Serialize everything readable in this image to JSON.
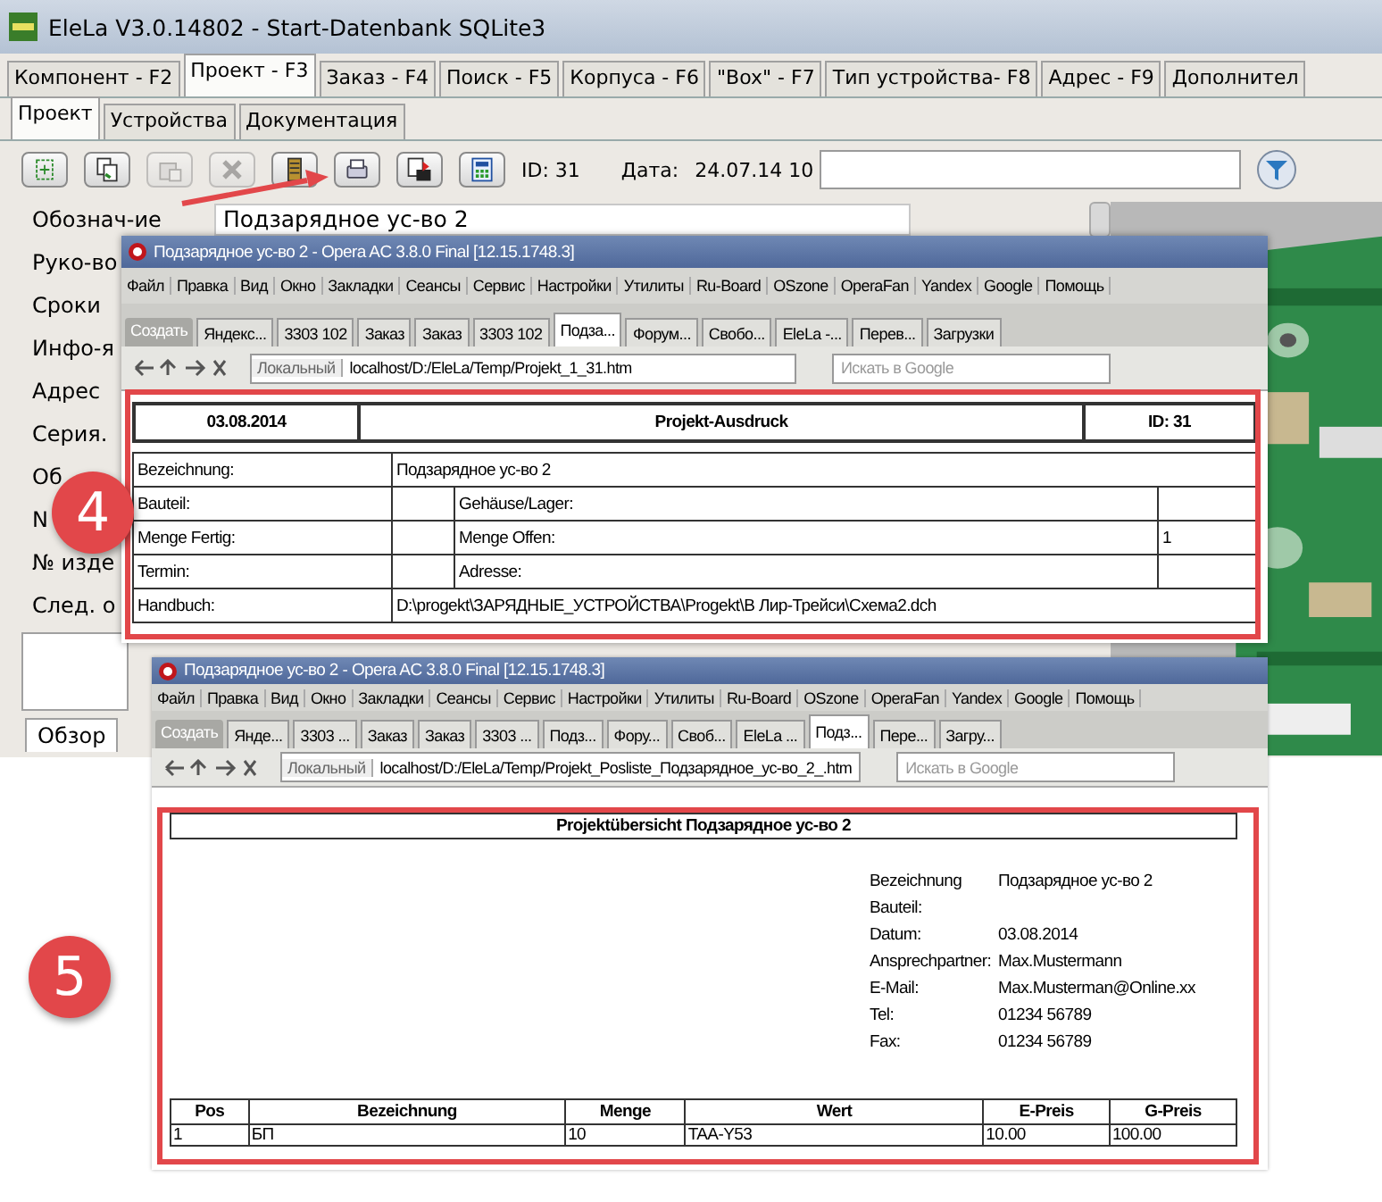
{
  "window": {
    "title": "EleLa V3.0.14802  - Start-Datenbank SQLite3"
  },
  "main_tabs": [
    {
      "label": "Компонент - F2",
      "selected": false
    },
    {
      "label": "Проект - F3",
      "selected": true
    },
    {
      "label": "Заказ - F4",
      "selected": false
    },
    {
      "label": "Поиск - F5",
      "selected": false
    },
    {
      "label": "Корпуса - F6",
      "selected": false
    },
    {
      "label": "\"Box\" - F7",
      "selected": false
    },
    {
      "label": "Тип устройства- F8",
      "selected": false
    },
    {
      "label": "Адрес - F9",
      "selected": false
    },
    {
      "label": "Дополнител",
      "selected": false
    }
  ],
  "sub_tabs": [
    {
      "label": "Проект",
      "selected": true
    },
    {
      "label": "Устройства",
      "selected": false
    },
    {
      "label": "Документация",
      "selected": false
    }
  ],
  "toolbar": {
    "buttons": [
      {
        "kind": "new",
        "disabled": false
      },
      {
        "kind": "copy",
        "disabled": false
      },
      {
        "kind": "paste",
        "disabled": true
      },
      {
        "kind": "delete",
        "disabled": true
      },
      {
        "kind": "book",
        "disabled": false
      },
      {
        "kind": "print",
        "disabled": false
      },
      {
        "kind": "export",
        "disabled": false
      },
      {
        "kind": "calc",
        "disabled": false
      }
    ],
    "id_text": "ID: 31",
    "date_label": "Дата:",
    "date_value": "24.07.14 10"
  },
  "form": {
    "fields": [
      {
        "label": "Обознач-ие",
        "value": "Подзарядное ус-во 2"
      },
      {
        "label": "Руко-во"
      },
      {
        "label": "Сроки"
      },
      {
        "label": "Инфо-я"
      },
      {
        "label": "Адрес"
      },
      {
        "label": "Серия."
      },
      {
        "label": "Об"
      },
      {
        "label": "N"
      },
      {
        "label": "№ изде"
      },
      {
        "label": "След. о"
      }
    ]
  },
  "bottom_tabs": [
    {
      "label": "Обзор",
      "selected": true
    }
  ],
  "browsers": [
    {
      "title": "Подзарядное ус-во 2 - Opera AC 3.8.0 Final [12.15.1748.3]",
      "menu": [
        "Файл",
        "Правка",
        "Вид",
        "Окно",
        "Закладки",
        "Сеансы",
        "Сервис",
        "Настройки",
        "Утилиты",
        "Ru-Board",
        "OSzone",
        "OperaFan",
        "Yandex",
        "Google",
        "Помощь"
      ],
      "new_tab": "Создать",
      "tabs": [
        {
          "label": "Яндекс...",
          "selected": false
        },
        {
          "label": "3303 102",
          "selected": false
        },
        {
          "label": "Заказ",
          "selected": false
        },
        {
          "label": "Заказ",
          "selected": false
        },
        {
          "label": "3303 102",
          "selected": false
        },
        {
          "label": "Подза...",
          "selected": true
        },
        {
          "label": "Форум...",
          "selected": false
        },
        {
          "label": "Свобо...",
          "selected": false
        },
        {
          "label": "EleLa -...",
          "selected": false
        },
        {
          "label": "Перев...",
          "selected": false
        },
        {
          "label": "Загрузки",
          "selected": false
        }
      ],
      "address_prefix": "Локальный",
      "url": "localhost/D:/EleLa/Temp/Projekt_1_31.htm",
      "search_placeholder": "Искать в Google",
      "report": {
        "kind": "printout",
        "header": [
          "03.08.2014",
          "Projekt-Ausdruck",
          "ID: 31"
        ],
        "rows": [
          {
            "kind": "wide",
            "cells": [
              "Bezeichnung:",
              {
                "text": "Подзарядное ус-во 2",
                "colspan": 3
              }
            ]
          },
          {
            "kind": "split",
            "cells": [
              "Bauteil:",
              null,
              "Gehäuse/Lager:",
              null
            ]
          },
          {
            "kind": "split",
            "cells": [
              "Menge Fertig:",
              null,
              "Menge Offen:",
              "1"
            ]
          },
          {
            "kind": "split",
            "cells": [
              "Termin:",
              null,
              "Adresse:",
              null
            ]
          },
          {
            "kind": "wide",
            "cells": [
              "Handbuch:",
              {
                "text": "D:\\progekt\\ЗАРЯДНЫЕ_УСТРОЙСТВА\\Progekt\\В Лир-Трейси\\Схема2.dch",
                "colspan": 3
              }
            ]
          }
        ]
      },
      "badge": "4"
    },
    {
      "title": "Подзарядное ус-во 2 - Opera AC 3.8.0 Final [12.15.1748.3]",
      "menu": [
        "Файл",
        "Правка",
        "Вид",
        "Окно",
        "Закладки",
        "Сеансы",
        "Сервис",
        "Настройки",
        "Утилиты",
        "Ru-Board",
        "OSzone",
        "OperaFan",
        "Yandex",
        "Google",
        "Помощь"
      ],
      "new_tab": "Создать",
      "tabs": [
        {
          "label": "Янде...",
          "selected": false
        },
        {
          "label": "3303 ...",
          "selected": false
        },
        {
          "label": "Заказ",
          "selected": false
        },
        {
          "label": "Заказ",
          "selected": false
        },
        {
          "label": "3303 ...",
          "selected": false
        },
        {
          "label": "Подз...",
          "selected": false
        },
        {
          "label": "Фору...",
          "selected": false
        },
        {
          "label": "Своб...",
          "selected": false
        },
        {
          "label": "EleLa ...",
          "selected": false
        },
        {
          "label": "Подз...",
          "selected": true
        },
        {
          "label": "Пере...",
          "selected": false
        },
        {
          "label": "Загру...",
          "selected": false
        }
      ],
      "address_prefix": "Локальный",
      "url": "localhost/D:/EleLa/Temp/Projekt_Posliste_Подзарядное_ус-во_2_.htm",
      "search_placeholder": "Искать в Google",
      "report": {
        "kind": "overview",
        "title": "Projektübersicht Подзарядное ус-во 2",
        "info": [
          [
            "Bezeichnung",
            "Подзарядное ус-во 2"
          ],
          [
            "Bauteil:"
          ],
          [
            "Datum:",
            "03.08.2014"
          ],
          [
            "Ansprechpartner:",
            "Max.Mustermann"
          ],
          [
            "E-Mail:",
            "Max.Musterman@Online.xx"
          ],
          [
            "Tel:",
            "01234 56789"
          ],
          [
            "Fax:",
            "01234 56789"
          ]
        ],
        "columns": [
          "Pos",
          "Bezeichnung",
          "Menge",
          "Wert",
          "E-Preis",
          "G-Preis"
        ],
        "rows": [
          [
            "1",
            "БП",
            "10",
            "TAA-Y53",
            "10.00",
            "100.00"
          ]
        ]
      },
      "badge": "5"
    }
  ]
}
